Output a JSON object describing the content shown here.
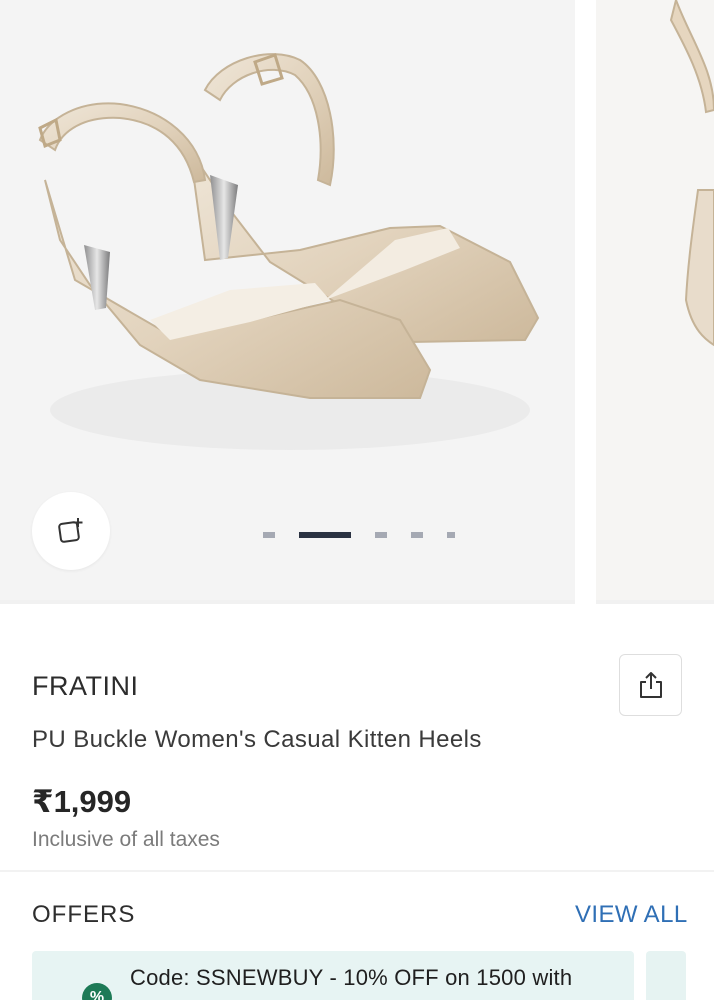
{
  "product": {
    "brand": "FRATINI",
    "title": "PU Buckle Women's Casual Kitten Heels",
    "price": "₹1,999",
    "tax_note": "Inclusive of all taxes"
  },
  "gallery": {
    "image_count": 5,
    "active_index": 1
  },
  "offers": {
    "heading": "OFFERS",
    "view_all_label": "VIEW ALL",
    "items": [
      {
        "text": "Code: SSNEWBUY - 10% OFF on 1500 with",
        "icon_glyph": "%"
      }
    ]
  },
  "icons": {
    "add_icon": "add-to-collection-icon",
    "share_icon": "share-icon",
    "offer_icon": "percent-badge-icon"
  },
  "colors": {
    "link": "#2f6fb5",
    "offer_bg": "#e7f4f3",
    "offer_icon": "#1d7a56",
    "dot_active": "#2a3241",
    "dot_inactive": "#a5a9b3"
  }
}
